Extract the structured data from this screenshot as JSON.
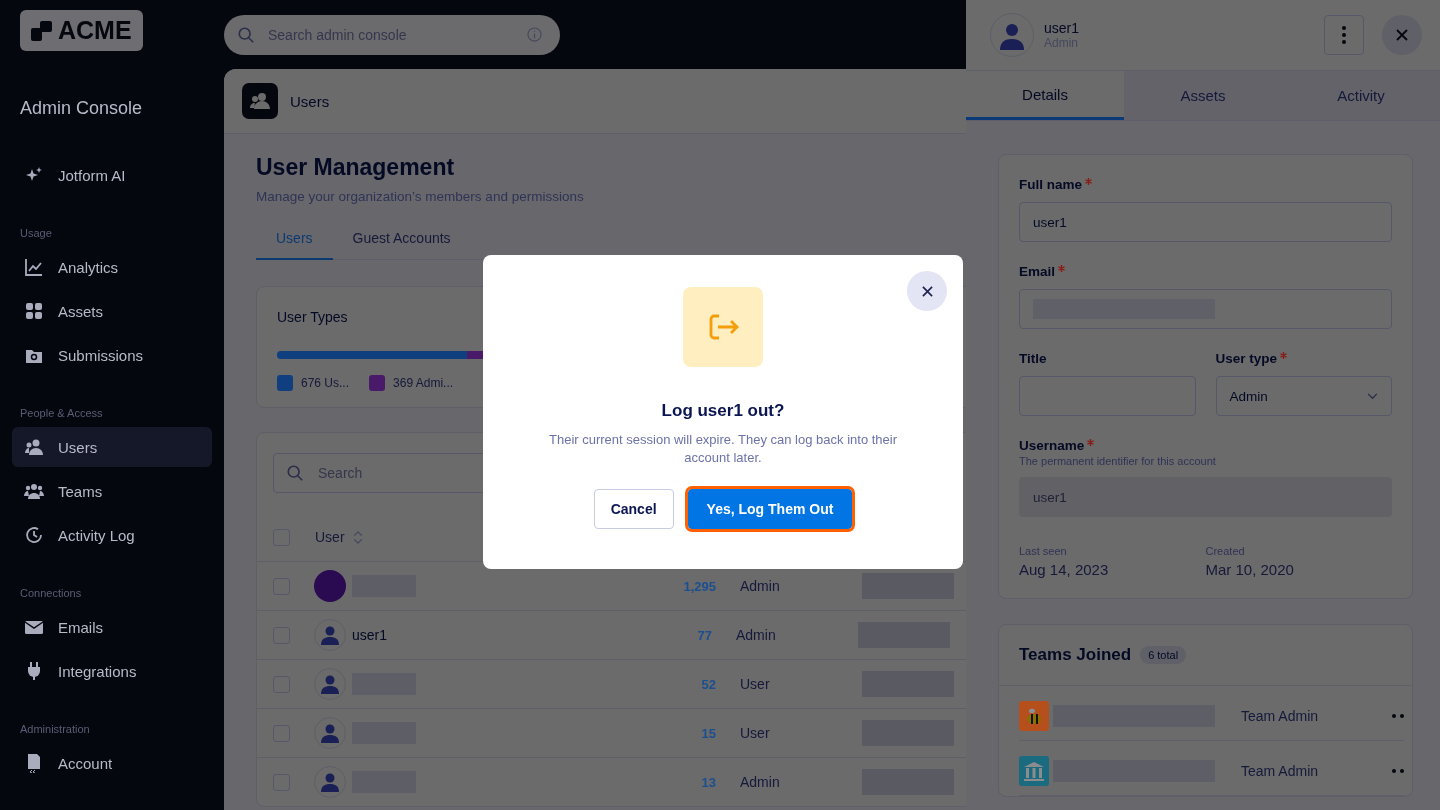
{
  "logo": {
    "text": "ACME"
  },
  "search": {
    "placeholder": "Search admin console"
  },
  "sidebar": {
    "title": "Admin Console",
    "sections": [
      {
        "items": [
          {
            "label": "Jotform AI",
            "kind": "sparkle",
            "selected": false
          }
        ]
      },
      {
        "heading": "Usage",
        "items": [
          {
            "label": "Analytics",
            "kind": "chart",
            "selected": false
          },
          {
            "label": "Assets",
            "kind": "grid",
            "selected": false
          },
          {
            "label": "Submissions",
            "kind": "folder",
            "selected": false
          }
        ]
      },
      {
        "heading": "People & Access",
        "items": [
          {
            "label": "Users",
            "kind": "user",
            "selected": true
          },
          {
            "label": "Teams",
            "kind": "team",
            "selected": false
          },
          {
            "label": "Activity Log",
            "kind": "clock",
            "selected": false
          }
        ]
      },
      {
        "heading": "Connections",
        "items": [
          {
            "label": "Emails",
            "kind": "mail",
            "selected": false
          },
          {
            "label": "Integrations",
            "kind": "plug",
            "selected": false
          }
        ]
      },
      {
        "heading": "Administration",
        "items": [
          {
            "label": "Account",
            "kind": "doc",
            "selected": false
          }
        ]
      }
    ]
  },
  "page": {
    "header": "Users",
    "title": "User Management",
    "subtitle": "Manage your organization’s members and permissions",
    "tabs": [
      {
        "label": "Users",
        "selected": true
      },
      {
        "label": "Guest Accounts",
        "selected": false
      }
    ],
    "user_types": {
      "title": "User Types",
      "segments": [
        {
          "label": "676 Us...",
          "color": "#0f3f7e",
          "level": 0.28
        },
        {
          "label": "369 Admi...",
          "color": "#4a1a6a"
        }
      ]
    },
    "table": {
      "search_placeholder": "Search",
      "select_all_checked": false,
      "columns": [
        {
          "label": "User",
          "sortable": true
        }
      ],
      "rows": [
        {
          "kind": "photo",
          "count": "1,295",
          "type": "Admin",
          "checked": false
        },
        {
          "kind": "generic",
          "name": "user1",
          "count": "77",
          "type": "Admin",
          "checked": false
        },
        {
          "kind": "generic",
          "count": "52",
          "type": "User",
          "checked": false
        },
        {
          "kind": "generic",
          "count": "15",
          "type": "User",
          "checked": false
        },
        {
          "kind": "generic",
          "count": "13",
          "type": "Admin",
          "checked": false
        }
      ]
    }
  },
  "dialog": {
    "title": "Log user1 out?",
    "message": "Their current session will expire. They can log back into their account later.",
    "buttons": [
      {
        "label": "Cancel",
        "kind": "secondary"
      },
      {
        "label": "Yes, Log Them Out",
        "kind": "primary"
      }
    ]
  },
  "drawer": {
    "name": "user1",
    "role": "Admin",
    "tabs": [
      {
        "label": "Details",
        "selected": true
      },
      {
        "label": "Assets",
        "selected": false
      },
      {
        "label": "Activity",
        "selected": false
      }
    ],
    "field_rows": [
      {
        "fields": [
          {
            "label": "Full name",
            "required": true,
            "kind": "text",
            "value": "user1"
          }
        ]
      },
      {
        "fields": [
          {
            "label": "Email",
            "required": true,
            "kind": "redacted"
          }
        ]
      },
      {
        "fields": [
          {
            "label": "Title",
            "required": false,
            "kind": "text"
          },
          {
            "label": "User type",
            "required": true,
            "kind": "select",
            "value": "Admin"
          }
        ]
      },
      {
        "fields": [
          {
            "label": "Username",
            "required": true,
            "kind": "disabled",
            "hint": "The permanent identifier for this account",
            "value": "user1"
          }
        ]
      }
    ],
    "dates": [
      {
        "label": "Last seen",
        "value": "Aug 14, 2023"
      },
      {
        "label": "Created",
        "value": "Mar 10, 2020"
      }
    ],
    "teams": {
      "title": "Teams Joined",
      "badge": "6 total",
      "rows": [
        {
          "kind": "bee",
          "color": "#b5501c",
          "role": "Team Admin"
        },
        {
          "kind": "building",
          "color": "#1a6a80",
          "role": "Team Admin"
        }
      ]
    }
  }
}
